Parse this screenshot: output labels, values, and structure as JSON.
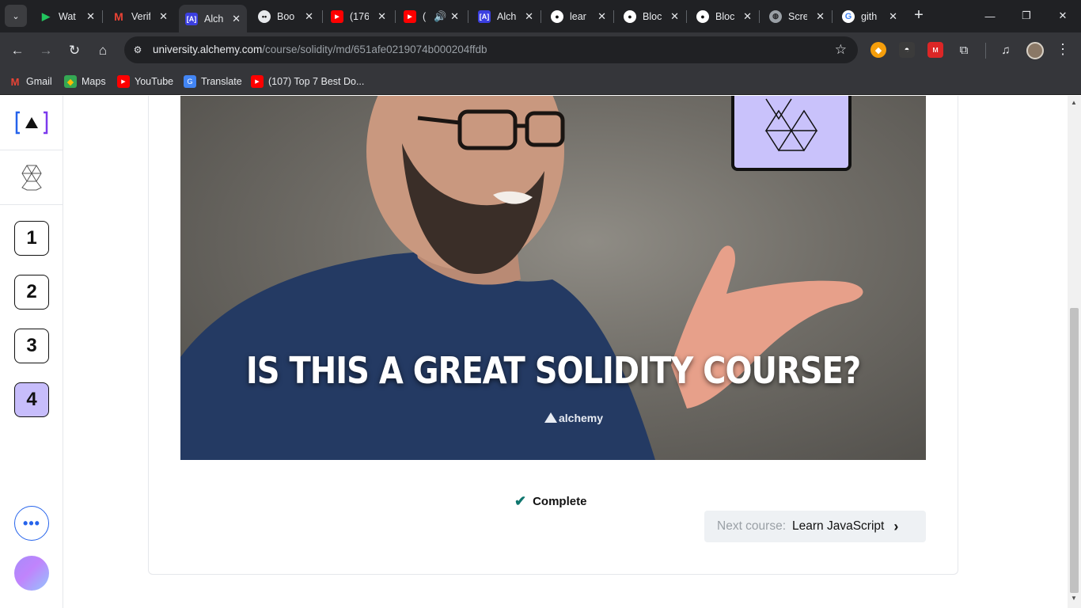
{
  "browser": {
    "tabs": [
      {
        "title": "Wat",
        "favicon": "play-icon",
        "color": "#22c55e"
      },
      {
        "title": "Verif",
        "favicon": "gmail-icon",
        "color": "#ea4335"
      },
      {
        "title": "Alch",
        "favicon": "alchemy-icon",
        "color": "#3b3fe0"
      },
      {
        "title": "Boo",
        "favicon": "ghost-icon",
        "color": "#111111"
      },
      {
        "title": "(176",
        "favicon": "youtube-icon",
        "color": "#ff0000"
      },
      {
        "title": "(",
        "favicon": "youtube-icon",
        "color": "#ff0000"
      },
      {
        "title": "Alch",
        "favicon": "alchemy-icon",
        "color": "#3b3fe0"
      },
      {
        "title": "lear",
        "favicon": "github-icon",
        "color": "#ffffff"
      },
      {
        "title": "Bloc",
        "favicon": "github-icon",
        "color": "#ffffff"
      },
      {
        "title": "Bloc",
        "favicon": "github-icon",
        "color": "#ffffff"
      },
      {
        "title": "Scre",
        "favicon": "globe-icon",
        "color": "#9aa0a6"
      },
      {
        "title": "gith",
        "favicon": "google-icon",
        "color": "#4285f4"
      }
    ],
    "active_tab_index": 2,
    "address": {
      "host": "university.alchemy.com",
      "path": "/course/solidity/md/651afe0219074b000204ffdb"
    },
    "bookmarks": [
      {
        "label": "Gmail",
        "icon": "gmail-icon"
      },
      {
        "label": "Maps",
        "icon": "maps-icon"
      },
      {
        "label": "YouTube",
        "icon": "youtube-icon"
      },
      {
        "label": "Translate",
        "icon": "translate-icon"
      },
      {
        "label": "(107) Top 7 Best Do...",
        "icon": "youtube-icon"
      }
    ]
  },
  "sidebar": {
    "logo_text": "[A]",
    "steps": [
      {
        "number": "1",
        "current": false
      },
      {
        "number": "2",
        "current": false
      },
      {
        "number": "3",
        "current": false
      },
      {
        "number": "4",
        "current": true
      }
    ],
    "more_label": "•••"
  },
  "main": {
    "video_title": "IS THIS A GREAT SOLIDITY COURSE?",
    "complete_label": "Complete",
    "next_course": {
      "label": "Next course:",
      "value": "Learn JavaScript"
    }
  },
  "colors": {
    "accent_purple": "#c7bdfb",
    "check_teal": "#0f766e",
    "more_blue": "#2563eb"
  }
}
